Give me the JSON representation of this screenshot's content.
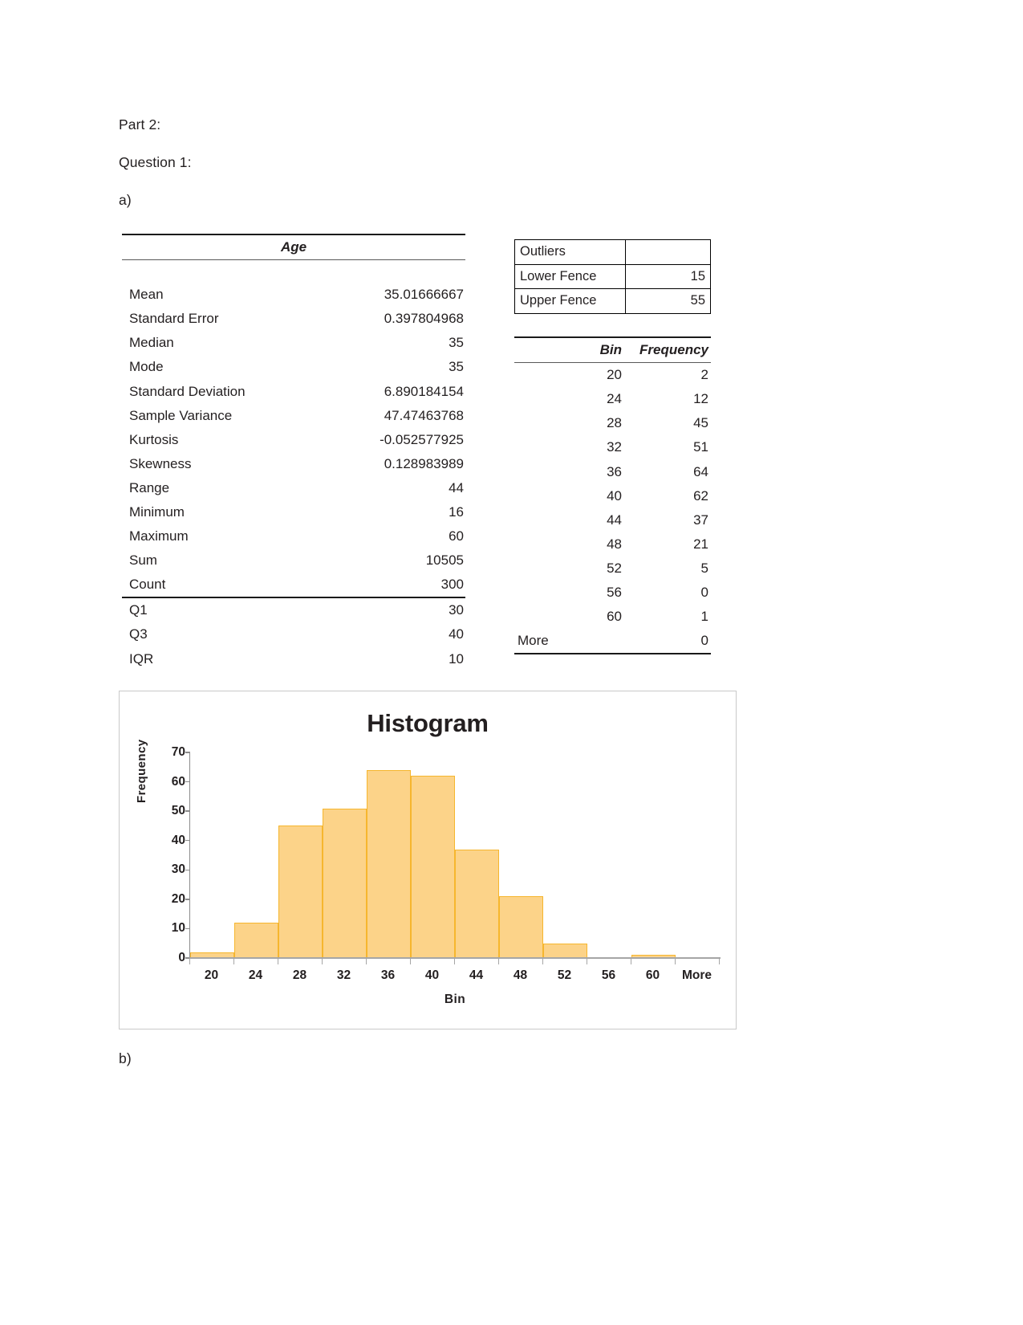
{
  "document": {
    "headings": {
      "part": "Part 2:",
      "question": "Question 1:",
      "item_a": "a)",
      "item_b": "b)"
    }
  },
  "stats_table": {
    "column_header": "Age",
    "rows": [
      {
        "label": "Mean",
        "value": "35.01666667"
      },
      {
        "label": "Standard Error",
        "value": "0.397804968"
      },
      {
        "label": "Median",
        "value": "35"
      },
      {
        "label": "Mode",
        "value": "35"
      },
      {
        "label": "Standard Deviation",
        "value": "6.890184154"
      },
      {
        "label": "Sample Variance",
        "value": "47.47463768"
      },
      {
        "label": "Kurtosis",
        "value": "-0.052577925"
      },
      {
        "label": "Skewness",
        "value": "0.128983989"
      },
      {
        "label": "Range",
        "value": "44"
      },
      {
        "label": "Minimum",
        "value": "16"
      },
      {
        "label": "Maximum",
        "value": "60"
      },
      {
        "label": "Sum",
        "value": "10505"
      },
      {
        "label": "Count",
        "value": "300"
      }
    ],
    "quartile_rows": [
      {
        "label": "Q1",
        "value": "30"
      },
      {
        "label": "Q3",
        "value": "40"
      },
      {
        "label": "IQR",
        "value": "10"
      }
    ]
  },
  "outliers_table": {
    "rows": [
      {
        "label": "Outliers",
        "value": ""
      },
      {
        "label": "Lower Fence",
        "value": "15"
      },
      {
        "label": "Upper Fence",
        "value": "55"
      }
    ]
  },
  "bin_table": {
    "headers": {
      "bin": "Bin",
      "frequency": "Frequency"
    },
    "rows": [
      {
        "bin": "20",
        "frequency": "2"
      },
      {
        "bin": "24",
        "frequency": "12"
      },
      {
        "bin": "28",
        "frequency": "45"
      },
      {
        "bin": "32",
        "frequency": "51"
      },
      {
        "bin": "36",
        "frequency": "64"
      },
      {
        "bin": "40",
        "frequency": "62"
      },
      {
        "bin": "44",
        "frequency": "37"
      },
      {
        "bin": "48",
        "frequency": "21"
      },
      {
        "bin": "52",
        "frequency": "5"
      },
      {
        "bin": "56",
        "frequency": "0"
      },
      {
        "bin": "60",
        "frequency": "1"
      },
      {
        "bin": "More",
        "frequency": "0"
      }
    ]
  },
  "chart_data": {
    "type": "bar",
    "title": "Histogram",
    "xlabel": "Bin",
    "ylabel": "Frequency",
    "categories": [
      "20",
      "24",
      "28",
      "32",
      "36",
      "40",
      "44",
      "48",
      "52",
      "56",
      "60",
      "More"
    ],
    "values": [
      2,
      12,
      45,
      51,
      64,
      62,
      37,
      21,
      5,
      0,
      1,
      0
    ],
    "ylim": [
      0,
      70
    ],
    "yticks": [
      0,
      10,
      20,
      30,
      40,
      50,
      60,
      70
    ],
    "grid": false,
    "legend": "none",
    "bar_fill": "#FCD389",
    "bar_border": "#F6B62E"
  }
}
